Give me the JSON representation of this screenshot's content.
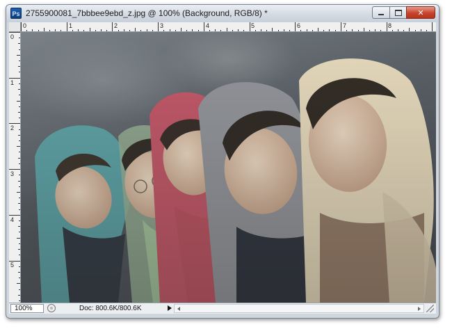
{
  "window": {
    "title": "2755900081_7bbbee9ebd_z.jpg @ 100% (Background, RGB/8) *",
    "app_icon_text": "Ps"
  },
  "rulers": {
    "horizontal_labels": [
      "0",
      "1",
      "2",
      "3",
      "4",
      "5",
      "6",
      "7",
      "8"
    ],
    "vertical_labels": [
      "0",
      "1",
      "2",
      "3",
      "4",
      "5"
    ]
  },
  "canvas": {
    "content": "photo"
  },
  "statusbar": {
    "zoom": "100%",
    "doc_info": "Doc: 800.6K/800.6K"
  },
  "colors": {
    "close_button": "#c8432d",
    "app_icon": "#1e5fae"
  }
}
